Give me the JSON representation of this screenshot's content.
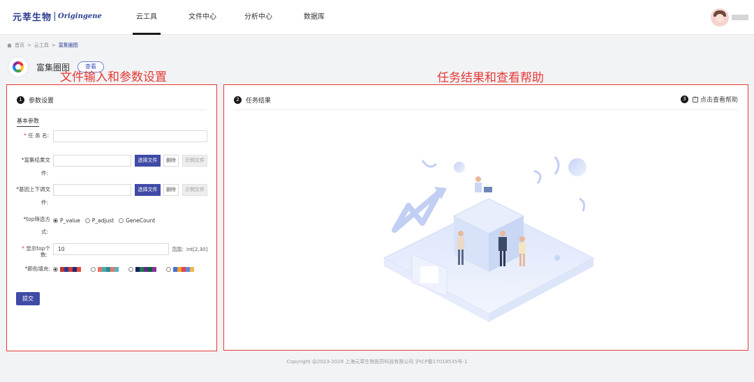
{
  "header": {
    "logo_cn": "元莘生物",
    "logo_en": "Origingene",
    "nav": [
      "云工具",
      "文件中心",
      "分析中心",
      "数据库"
    ],
    "active_nav": 0
  },
  "breadcrumb": {
    "home": "首页",
    "level1": "云工具",
    "current": "富集圈图",
    "separator": ">"
  },
  "tool": {
    "title": "富集圈图",
    "view_button": "查看"
  },
  "annotations": {
    "left": "文件输入和参数设置",
    "right": "任务结果和查看帮助"
  },
  "left_panel": {
    "number": "1",
    "title": "参数设置",
    "tab": "基本参数",
    "fields": {
      "task_name": {
        "label": "任 务 名:",
        "value": ""
      },
      "enrich_file": {
        "label_line1": "*富集结果文",
        "label_line2": "件:",
        "value": ""
      },
      "gene_file": {
        "label_line1": "*基因上下调文",
        "label_line2": "件:",
        "value": ""
      },
      "top_filter": {
        "label_line1": "*top筛选方",
        "label_line2": "式:",
        "options": [
          "P_value",
          "P_adjust",
          "GeneCount"
        ],
        "selected": 0
      },
      "top_count": {
        "label_line1": "显示top个",
        "label_line2": "数:",
        "value": "10",
        "range": "范围：int[2,30]"
      },
      "color_fill": {
        "label": "*颜色填充:",
        "selected": 0
      }
    },
    "buttons": {
      "select_file": "选择文件",
      "delete": "删除",
      "example_file": "示例文件"
    },
    "submit": "提交",
    "palettes": [
      [
        "#c0392b",
        "#2e3a8c",
        "#d63a3a",
        "#1f2a6b",
        "#e74c3c"
      ],
      [
        "#e57368",
        "#4aa8b0",
        "#2e8b8b",
        "#e07b6f",
        "#58b5bd"
      ],
      [
        "#1b1f5e",
        "#1b7a4a",
        "#5e2a8a",
        "#0f5e3a",
        "#8c2f9e"
      ],
      [
        "#4a6fd1",
        "#f0a030",
        "#e2454a",
        "#5d8ae0",
        "#f6b64a"
      ]
    ]
  },
  "right_panel": {
    "number_left": "2",
    "title": "任务结果",
    "number_right": "3",
    "help": "点击查看帮助"
  },
  "footer": "Copyright @2023-2028 上海元莘生物医药科技有限公司 沪ICP备17018535号-1",
  "colors": {
    "primary": "#3f4ba5",
    "annotation": "#e53935",
    "brand": "#2c3d8f"
  }
}
